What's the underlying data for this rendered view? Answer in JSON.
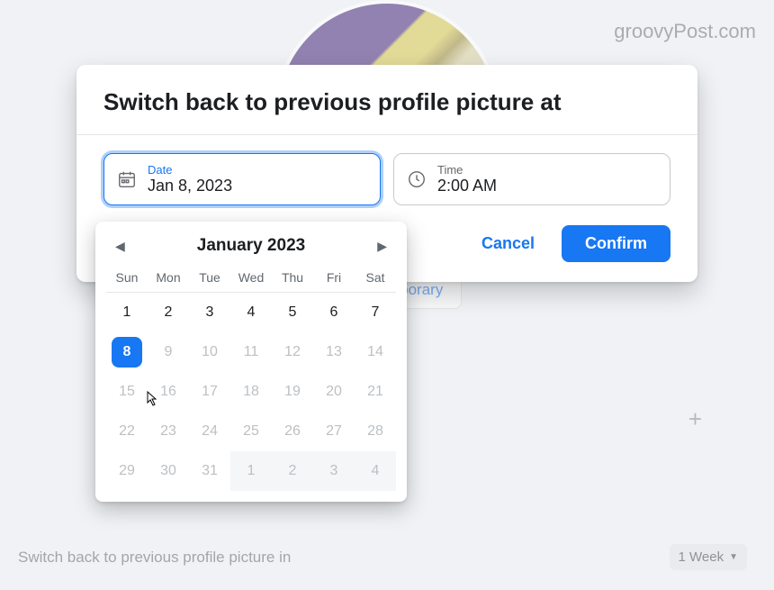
{
  "watermark": "groovyPost.com",
  "dialog": {
    "title": "Switch back to previous profile picture at",
    "date_field": {
      "label": "Date",
      "value": "Jan 8, 2023"
    },
    "time_field": {
      "label": "Time",
      "value": "2:00 AM"
    },
    "cancel_label": "Cancel",
    "confirm_label": "Confirm"
  },
  "calendar": {
    "month_label": "January 2023",
    "weekdays": [
      "Sun",
      "Mon",
      "Tue",
      "Wed",
      "Thu",
      "Fri",
      "Sat"
    ],
    "weeks": [
      [
        {
          "n": 1,
          "state": "normal"
        },
        {
          "n": 2,
          "state": "normal"
        },
        {
          "n": 3,
          "state": "normal"
        },
        {
          "n": 4,
          "state": "normal"
        },
        {
          "n": 5,
          "state": "normal"
        },
        {
          "n": 6,
          "state": "normal"
        },
        {
          "n": 7,
          "state": "normal"
        }
      ],
      [
        {
          "n": 8,
          "state": "selected"
        },
        {
          "n": 9,
          "state": "disabled"
        },
        {
          "n": 10,
          "state": "disabled"
        },
        {
          "n": 11,
          "state": "disabled"
        },
        {
          "n": 12,
          "state": "disabled"
        },
        {
          "n": 13,
          "state": "disabled"
        },
        {
          "n": 14,
          "state": "disabled"
        }
      ],
      [
        {
          "n": 15,
          "state": "disabled"
        },
        {
          "n": 16,
          "state": "disabled"
        },
        {
          "n": 17,
          "state": "disabled"
        },
        {
          "n": 18,
          "state": "disabled"
        },
        {
          "n": 19,
          "state": "disabled"
        },
        {
          "n": 20,
          "state": "disabled"
        },
        {
          "n": 21,
          "state": "disabled"
        }
      ],
      [
        {
          "n": 22,
          "state": "disabled"
        },
        {
          "n": 23,
          "state": "disabled"
        },
        {
          "n": 24,
          "state": "disabled"
        },
        {
          "n": 25,
          "state": "disabled"
        },
        {
          "n": 26,
          "state": "disabled"
        },
        {
          "n": 27,
          "state": "disabled"
        },
        {
          "n": 28,
          "state": "disabled"
        }
      ],
      [
        {
          "n": 29,
          "state": "disabled"
        },
        {
          "n": 30,
          "state": "disabled"
        },
        {
          "n": 31,
          "state": "disabled"
        },
        {
          "n": 1,
          "state": "next"
        },
        {
          "n": 2,
          "state": "next"
        },
        {
          "n": 3,
          "state": "next"
        },
        {
          "n": 4,
          "state": "next"
        }
      ]
    ]
  },
  "background": {
    "make_temporary_label": "ke Temporary",
    "switch_back_label": "Switch back to previous profile picture in",
    "duration_label": "1 Week"
  }
}
